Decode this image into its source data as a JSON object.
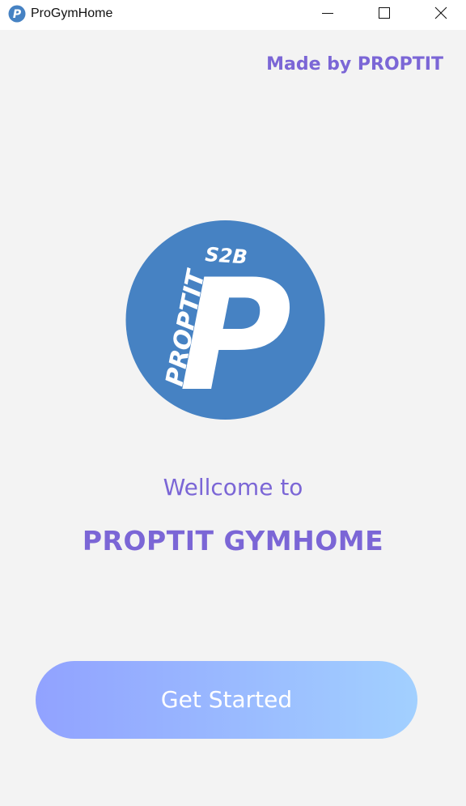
{
  "window": {
    "title": "ProGymHome",
    "app_icon": "p-logo-icon",
    "controls": [
      "minimize-icon",
      "maximize-icon",
      "close-icon"
    ]
  },
  "header": {
    "credit": "Made by PROPTIT"
  },
  "logo": {
    "icon": "proptit-logo",
    "text_vertical": "PROPTIT",
    "text_top": "S2B",
    "letter": "P"
  },
  "main": {
    "welcome": "Wellcome to",
    "app_name": "PROPTIT GYMHOME",
    "start_button": "Get Started"
  },
  "colors": {
    "accent": "#7b66d6",
    "logo_blue": "#4682c3",
    "button_gradient_start": "#91a2ff",
    "button_gradient_end": "#a2d0ff",
    "background": "#f3f3f3"
  }
}
